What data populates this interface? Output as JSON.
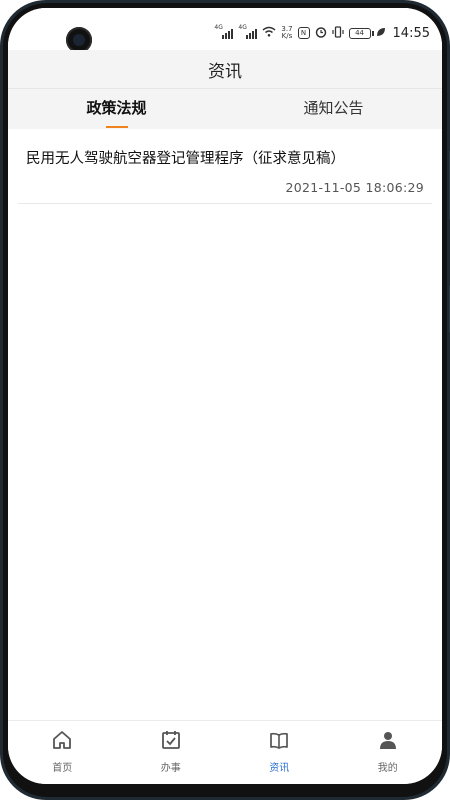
{
  "status": {
    "signal1_label": "4G",
    "signal2_label": "4G",
    "speed_value": "3.7",
    "speed_unit": "K/s",
    "battery": "44",
    "time": "14:55"
  },
  "header": {
    "title": "资讯"
  },
  "tabs": [
    {
      "label": "政策法规",
      "active": true
    },
    {
      "label": "通知公告",
      "active": false
    }
  ],
  "list": [
    {
      "title": "民用无人驾驶航空器登记管理程序（征求意见稿）",
      "date": "2021-11-05 18:06:29"
    }
  ],
  "bottom_nav": [
    {
      "label": "首页",
      "icon": "home-icon",
      "active": false
    },
    {
      "label": "办事",
      "icon": "calendar-check-icon",
      "active": false
    },
    {
      "label": "资讯",
      "icon": "book-icon",
      "active": true
    },
    {
      "label": "我的",
      "icon": "person-icon",
      "active": false
    }
  ],
  "colors": {
    "accent": "#f0831e",
    "nav_active": "#2b6fd6",
    "header_bg": "#f4f4f4"
  }
}
